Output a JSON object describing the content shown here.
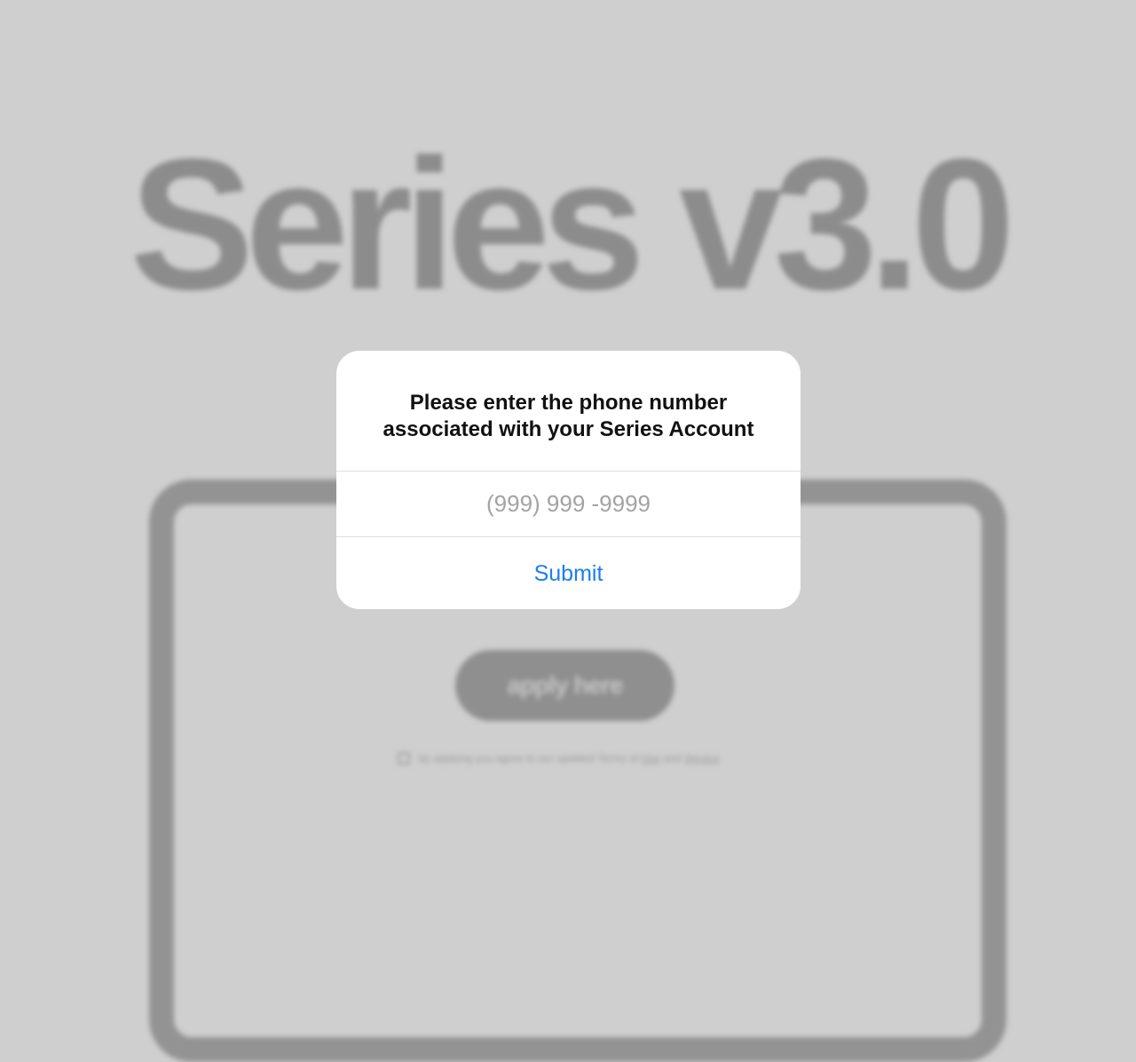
{
  "background": {
    "title": "Series v3.0",
    "apply_button_label": "apply here",
    "terms": {
      "prefix": "by applying you agree to our updated Terms of",
      "link1": "Use",
      "middle": "and",
      "link2": "Service"
    }
  },
  "dialog": {
    "title": "Please enter the phone number associated with your Series Account",
    "phone_placeholder": "(999) 999 -9999",
    "phone_value": "",
    "submit_label": "Submit"
  },
  "colors": {
    "overlay": "#cfcfcf",
    "dialog_bg": "#ffffff",
    "accent": "#1a7ef0"
  }
}
